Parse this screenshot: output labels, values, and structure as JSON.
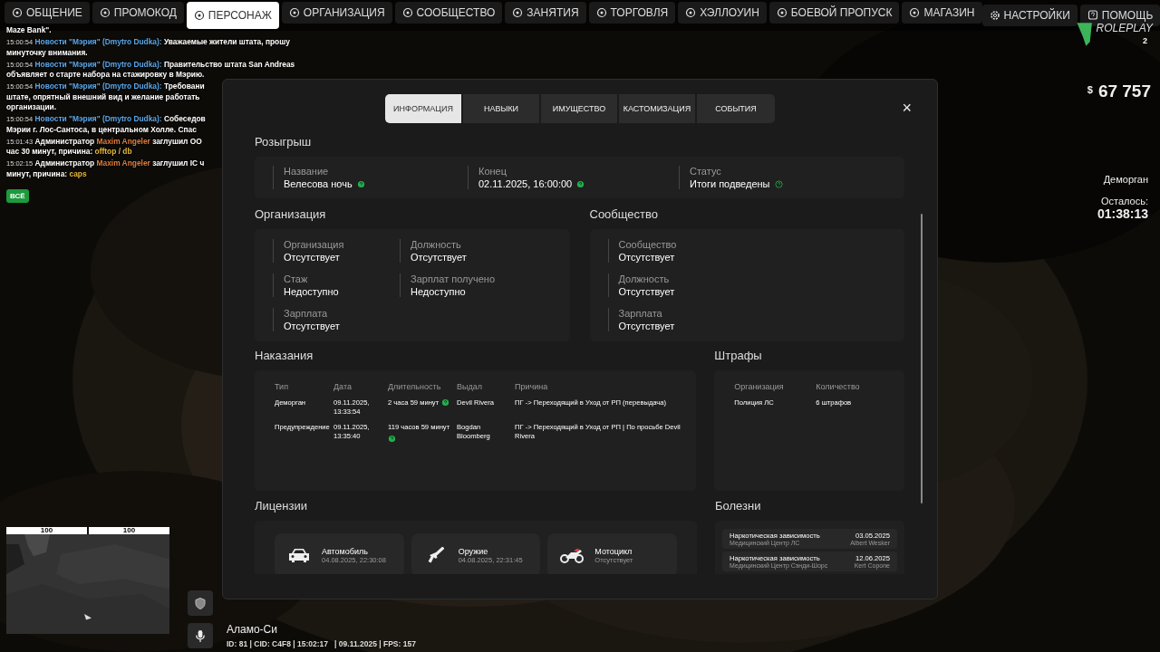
{
  "top_nav": {
    "tabs": [
      {
        "label": "ОБЩЕНИЕ",
        "selected": false
      },
      {
        "label": "ПРОМОКОД",
        "selected": false
      },
      {
        "label": "ПЕРСОНАЖ",
        "selected": true
      },
      {
        "label": "ОРГАНИЗАЦИЯ",
        "selected": false
      },
      {
        "label": "СООБЩЕСТВО",
        "selected": false
      },
      {
        "label": "ЗАНЯТИЯ",
        "selected": false
      },
      {
        "label": "ТОРГОВЛЯ",
        "selected": false
      },
      {
        "label": "ХЭЛЛОУИН",
        "selected": false
      },
      {
        "label": "БОЕВОЙ ПРОПУСК",
        "selected": false
      },
      {
        "label": "МАГАЗИН",
        "selected": false
      }
    ],
    "right_tabs": [
      {
        "label": "НАСТРОЙКИ",
        "selected": false
      },
      {
        "label": "ПОМОЩЬ",
        "selected": false
      }
    ]
  },
  "chat": {
    "lines": [
      [
        {
          "kind": "text",
          "text": "Maze Bank\"."
        }
      ],
      [
        {
          "kind": "time",
          "text": "15:00:54"
        },
        {
          "kind": "news",
          "text": "Новости \"Мэрия\" (Dmytro Dudka):"
        },
        {
          "kind": "text",
          "text": "Уважаемые жители штата, прошу"
        }
      ],
      [
        {
          "kind": "text",
          "text": "минуточку внимания."
        }
      ],
      [
        {
          "kind": "time",
          "text": "15:00:54"
        },
        {
          "kind": "news",
          "text": "Новости \"Мэрия\" (Dmytro Dudka):"
        },
        {
          "kind": "text",
          "text": "Правительство штата San Andreas"
        }
      ],
      [
        {
          "kind": "text",
          "text": "объявляет о старте набора на стажировку в Мэрию."
        }
      ],
      [
        {
          "kind": "time",
          "text": "15:00:54"
        },
        {
          "kind": "news",
          "text": "Новости \"Мэрия\" (Dmytro Dudka):"
        },
        {
          "kind": "text",
          "text": "Требовани"
        }
      ],
      [
        {
          "kind": "text",
          "text": "штате, опрятный внешний вид и желание работать"
        }
      ],
      [
        {
          "kind": "text",
          "text": "организации."
        }
      ],
      [
        {
          "kind": "time",
          "text": "15:00:54"
        },
        {
          "kind": "news",
          "text": "Новости \"Мэрия\" (Dmytro Dudka):"
        },
        {
          "kind": "text",
          "text": "Собеседов"
        }
      ],
      [
        {
          "kind": "text",
          "text": "Мэрии г. Лос-Сантоса, в центральном Холле. Спас"
        }
      ],
      [
        {
          "kind": "time",
          "text": "15:01:43"
        },
        {
          "kind": "text",
          "text": "Администратор"
        },
        {
          "kind": "name",
          "text": "Maxim Angeler"
        },
        {
          "kind": "text",
          "text": "заглушил ОО"
        }
      ],
      [
        {
          "kind": "text",
          "text": "час 30 минут, причина:"
        },
        {
          "kind": "reason",
          "text": "offtop / db"
        }
      ],
      [
        {
          "kind": "time",
          "text": "15:02:15"
        },
        {
          "kind": "text",
          "text": "Администратор"
        },
        {
          "kind": "name",
          "text": "Maxim Angeler"
        },
        {
          "kind": "text",
          "text": "заглушил IC ч"
        }
      ],
      [
        {
          "kind": "text",
          "text": "минут, причина:"
        },
        {
          "kind": "reason",
          "text": "caps"
        }
      ]
    ],
    "filter_button": "ВСЁ"
  },
  "logo": {
    "text": "ROLEPLAY",
    "badge": "2"
  },
  "money": {
    "currency": "$",
    "amount": "67 757"
  },
  "jail": {
    "label": "Деморган",
    "remaining_label": "Осталось:",
    "remaining": "01:38:13"
  },
  "modal": {
    "tabs": [
      {
        "label": "ИНФОРМАЦИЯ",
        "selected": true
      },
      {
        "label": "НАВЫКИ",
        "selected": false
      },
      {
        "label": "ИМУЩЕСТВО",
        "selected": false
      },
      {
        "label": "КАСТОМИЗАЦИЯ",
        "selected": false
      },
      {
        "label": "СОБЫТИЯ",
        "selected": false
      }
    ],
    "close": "×",
    "raffle": {
      "title": "Розыгрыш",
      "fields": [
        {
          "label": "Название",
          "value": "Велесова ночь",
          "hint": true,
          "hint_filled": true
        },
        {
          "label": "Конец",
          "value": "02.11.2025, 16:00:00",
          "hint": true,
          "hint_filled": true
        },
        {
          "label": "Статус",
          "value": "Итоги подведены",
          "hint": true,
          "hint_filled": false
        }
      ]
    },
    "organization": {
      "title": "Организация",
      "fields": [
        {
          "label": "Организация",
          "value": "Отсутствует"
        },
        {
          "label": "Должность",
          "value": "Отсутствует"
        },
        {
          "label": "Стаж",
          "value": "Недоступно"
        },
        {
          "label": "Зарплат получено",
          "value": "Недоступно"
        },
        {
          "label": "Зарплата",
          "value": "Отсутствует"
        }
      ]
    },
    "community": {
      "title": "Сообщество",
      "fields": [
        {
          "label": "Сообщество",
          "value": "Отсутствует"
        },
        {
          "label": "Должность",
          "value": "Отсутствует"
        },
        {
          "label": "Зарплата",
          "value": "Отсутствует"
        }
      ]
    },
    "punishments": {
      "title": "Наказания",
      "columns": [
        "Тип",
        "Дата",
        "Длительность",
        "Выдал",
        "Причина"
      ],
      "rows": [
        {
          "type": "Деморган",
          "date": "09.11.2025, 13:33:54",
          "duration": "2 часа 59 минут",
          "hint": true,
          "issuer": "Devil Rivera",
          "reason": "ПГ -> Переходящий в Уход от РП (перевыдача)"
        },
        {
          "type": "Предупреждение",
          "date": "09.11.2025, 13:35:40",
          "duration": "119 часов 59 минут",
          "hint": true,
          "issuer": "Bogdan Bloomberg",
          "reason": "ПГ -> Переходящий в Уход от РП | По просьбе Devil Rivera"
        }
      ]
    },
    "fines": {
      "title": "Штрафы",
      "columns": [
        "Организация",
        "Количество"
      ],
      "rows": [
        {
          "organization": "Полиция ЛС",
          "count": "6 штрафов"
        }
      ]
    },
    "licenses": {
      "title": "Лицензии",
      "items": [
        {
          "name": "Автомобиль",
          "date": "04.08.2025, 22:30:08"
        },
        {
          "name": "Оружие",
          "date": "04.08.2025, 22:31:45"
        },
        {
          "name": "Мотоцикл",
          "date": "Отсутствует"
        }
      ]
    },
    "diseases": {
      "title": "Болезни",
      "items": [
        {
          "name": "Наркотическая зависимость",
          "date": "03.05.2025",
          "clinic": "Медицинский Центр ЛС",
          "doctor": "Albert Wesker"
        },
        {
          "name": "Наркотическая зависимость",
          "date": "12.06.2025",
          "clinic": "Медицинский Центр Сэнди-Шорс",
          "doctor": "Kert Copone"
        }
      ]
    }
  },
  "hud": {
    "bars": [
      {
        "reading": "100",
        "level": 1
      },
      {
        "reading": "100",
        "level": 1
      }
    ],
    "location": "Аламо-Си",
    "status": "ID: 81 | CID: C4F8 | 15:02:17   | 09.11.2025 | FPS: 157"
  }
}
